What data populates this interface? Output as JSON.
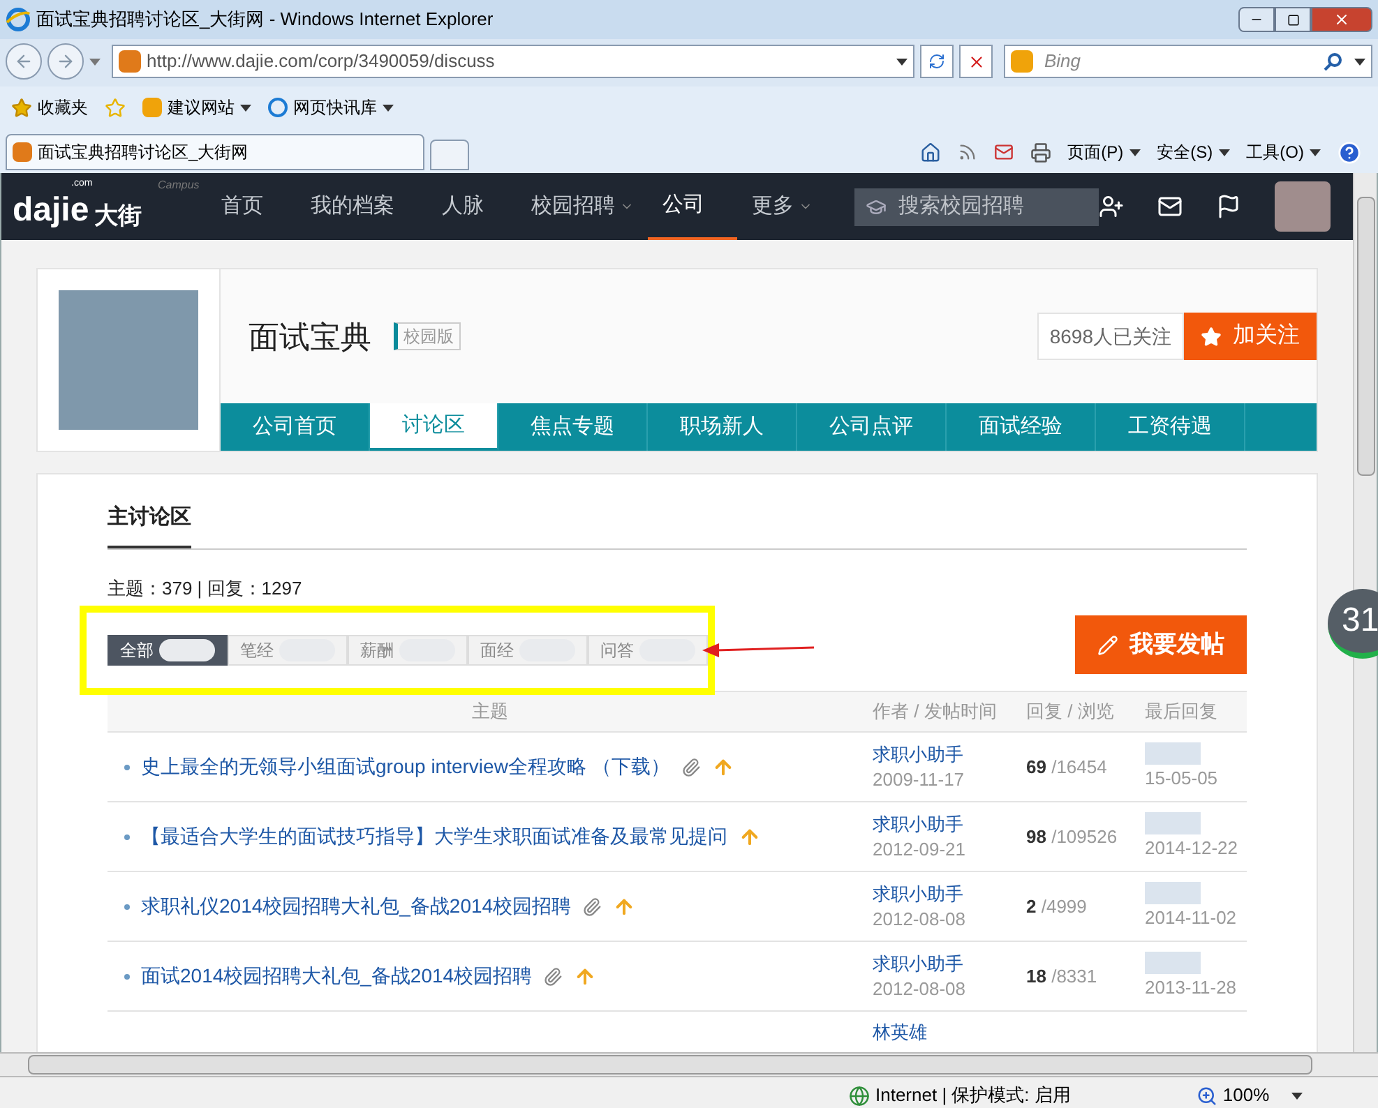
{
  "window": {
    "title": "面试宝典招聘讨论区_大街网 - Windows Internet Explorer"
  },
  "address_bar": {
    "url": "http://www.dajie.com/corp/3490059/discuss",
    "search_placeholder": "Bing"
  },
  "favorites_bar": {
    "items": [
      {
        "label": "收藏夹",
        "kind": "star"
      },
      {
        "label": "建议网站",
        "kind": "bing"
      },
      {
        "label": "网页快讯库",
        "kind": "ie"
      }
    ]
  },
  "browser_tab": {
    "title": "面试宝典招聘讨论区_大街网"
  },
  "command_bar": {
    "items": [
      "页面(P)",
      "安全(S)",
      "工具(O)"
    ]
  },
  "site_nav": {
    "logo": {
      "text": "dajie",
      "domain": ".com",
      "cn": "大街",
      "tag": "Campus"
    },
    "items": [
      {
        "label": "首页",
        "selected": false,
        "dropdown": false
      },
      {
        "label": "我的档案",
        "selected": false,
        "dropdown": false
      },
      {
        "label": "人脉",
        "selected": false,
        "dropdown": false
      },
      {
        "label": "校园招聘",
        "selected": false,
        "dropdown": true
      },
      {
        "label": "公司",
        "selected": true,
        "dropdown": false
      },
      {
        "label": "更多",
        "selected": false,
        "dropdown": true
      }
    ],
    "search_placeholder": "搜索校园招聘"
  },
  "company": {
    "name": "面试宝典",
    "badge": "校园版",
    "followers": "8698人已关注",
    "follow_button": "加关注",
    "tabs": [
      {
        "label": "公司首页",
        "selected": false
      },
      {
        "label": "讨论区",
        "selected": true
      },
      {
        "label": "焦点专题",
        "selected": false
      },
      {
        "label": "职场新人",
        "selected": false
      },
      {
        "label": "公司点评",
        "selected": false
      },
      {
        "label": "面试经验",
        "selected": false
      },
      {
        "label": "工资待遇",
        "selected": false
      }
    ]
  },
  "forum": {
    "title": "主讨论区",
    "stats": "主题：379 | 回复：1297",
    "filters": [
      {
        "label": "全部",
        "selected": true
      },
      {
        "label": "笔经",
        "selected": false
      },
      {
        "label": "薪酬",
        "selected": false
      },
      {
        "label": "面经",
        "selected": false
      },
      {
        "label": "问答",
        "selected": false
      }
    ],
    "post_button": "我要发帖",
    "columns": {
      "topic": "主题",
      "author": "作者",
      "time": "/ 发帖时间",
      "replies": "回复",
      "views": "/ 浏览",
      "last": "最后回复"
    },
    "rows": [
      {
        "title": "史上最全的无领导小组面试group interview全程攻略 （下载）",
        "attachment": true,
        "author": "求职小助手",
        "date": "2009-11-17",
        "replies": "69",
        "views": "/16454",
        "last": "15-05-05"
      },
      {
        "title": "【最适合大学生的面试技巧指导】大学生求职面试准备及最常见提问",
        "attachment": false,
        "author": "求职小助手",
        "date": "2012-09-21",
        "replies": "98",
        "views": "/109526",
        "last": "2014-12-22"
      },
      {
        "title": "求职礼仪2014校园招聘大礼包_备战2014校园招聘",
        "attachment": true,
        "author": "求职小助手",
        "date": "2012-08-08",
        "replies": "2",
        "views": "/4999",
        "last": "2014-11-02"
      },
      {
        "title": "面试2014校园招聘大礼包_备战2014校园招聘",
        "attachment": true,
        "author": "求职小助手",
        "date": "2012-08-08",
        "replies": "18",
        "views": "/8331",
        "last": "2013-11-28"
      },
      {
        "author": "林英雄"
      }
    ]
  },
  "side_widget": {
    "text": "31"
  },
  "status_bar": {
    "zone": "Internet | 保护模式: 启用",
    "zoom": "100%"
  }
}
